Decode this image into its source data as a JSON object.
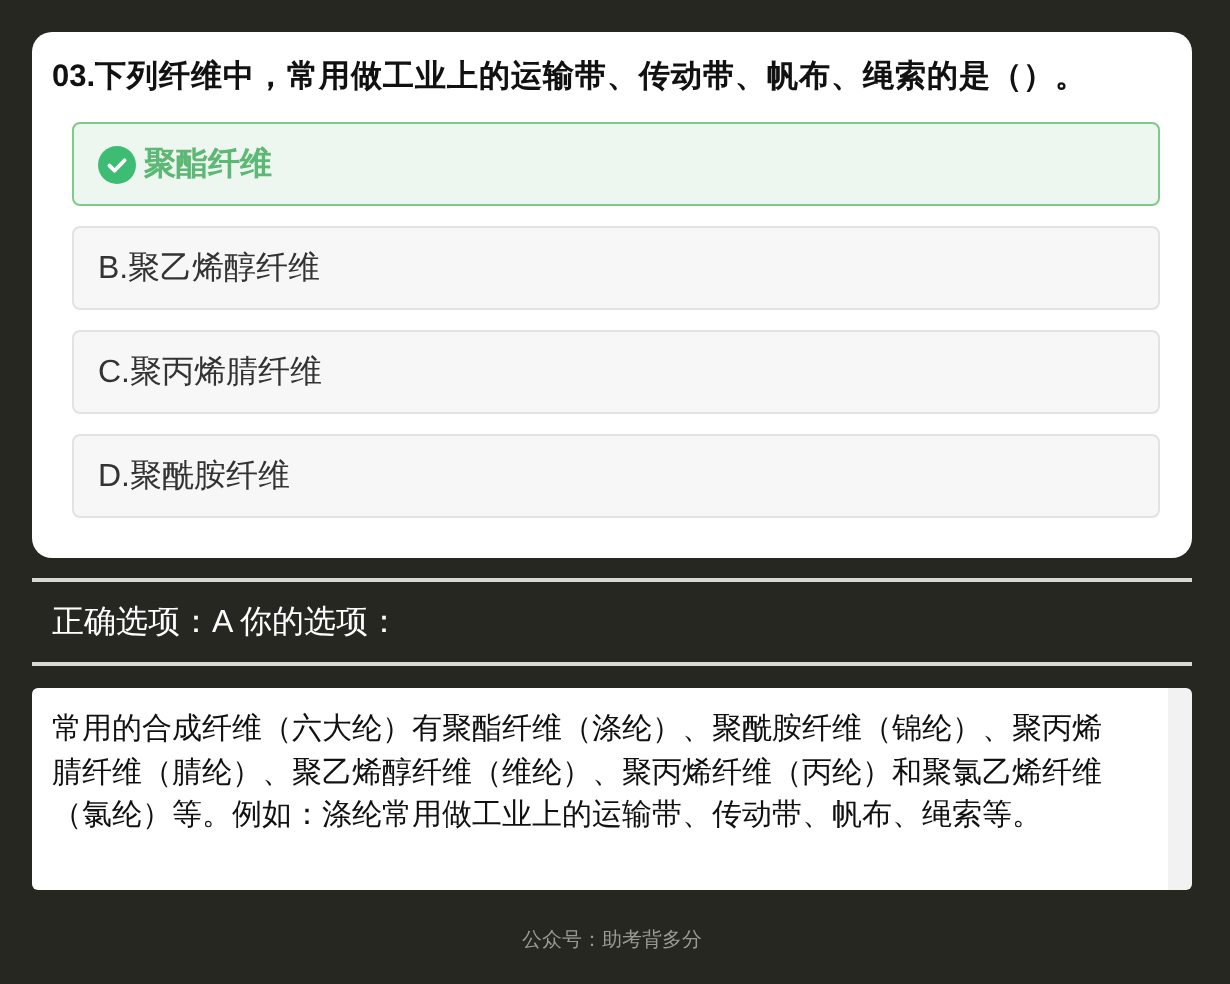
{
  "question": {
    "title": "03.下列纤维中，常用做工业上的运输带、传动带、帆布、绳索的是（）。",
    "options": [
      {
        "label": "聚酯纤维",
        "selected": true
      },
      {
        "label": "B.聚乙烯醇纤维",
        "selected": false
      },
      {
        "label": "C.聚丙烯腈纤维",
        "selected": false
      },
      {
        "label": "D.聚酰胺纤维",
        "selected": false
      }
    ]
  },
  "result": "正确选项：A 你的选项：",
  "explanation": "常用的合成纤维（六大纶）有聚酯纤维（涤纶）、聚酰胺纤维（锦纶）、聚丙烯腈纤维（腈纶）、聚乙烯醇纤维（维纶）、聚丙烯纤维（丙纶）和聚氯乙烯纤维（氯纶）等。例如：涤纶常用做工业上的运输带、传动带、帆布、绳索等。",
  "footer": "公众号：助考背多分"
}
